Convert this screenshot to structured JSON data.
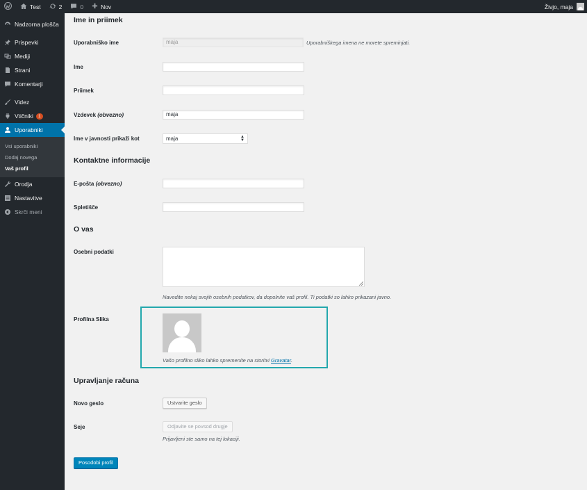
{
  "adminbar": {
    "site_name": "Test",
    "updates_count": "2",
    "comments_count": "0",
    "new_label": "Nov",
    "greeting": "Živjo, maja"
  },
  "sidebar": {
    "items": [
      {
        "label": "Nadzorna plošča",
        "icon": "dashboard-icon"
      },
      {
        "label": "Prispevki",
        "icon": "pin-icon"
      },
      {
        "label": "Mediji",
        "icon": "media-icon"
      },
      {
        "label": "Strani",
        "icon": "page-icon"
      },
      {
        "label": "Komentarji",
        "icon": "comment-icon"
      },
      {
        "label": "Videz",
        "icon": "brush-icon"
      },
      {
        "label": "Vtičniki",
        "icon": "plugin-icon",
        "badge": "1"
      },
      {
        "label": "Uporabniki",
        "icon": "user-icon"
      },
      {
        "label": "Orodja",
        "icon": "wrench-icon"
      },
      {
        "label": "Nastavitve",
        "icon": "settings-icon"
      },
      {
        "label": "Skrči meni",
        "icon": "collapse-icon"
      }
    ],
    "submenu": [
      "Vsi uporabniki",
      "Dodaj novega",
      "Vaš profil"
    ]
  },
  "name_section": {
    "heading": "Ime in priimek",
    "username_label": "Uporabniško ime",
    "username_value": "maja",
    "username_note": "Uporabniškega imena ne morete spreminjati.",
    "first_name_label": "Ime",
    "first_name_value": "",
    "last_name_label": "Priimek",
    "last_name_value": "",
    "nickname_label": "Vzdevek",
    "nickname_required": "(obvezno)",
    "nickname_value": "maja",
    "display_label": "Ime v javnosti prikaži kot",
    "display_value": "maja"
  },
  "contact_section": {
    "heading": "Kontaktne informacije",
    "email_label": "E-pošta",
    "email_required": "(obvezno)",
    "email_value": "",
    "website_label": "Spletišče",
    "website_value": ""
  },
  "about_section": {
    "heading": "O vas",
    "bio_label": "Osebni podatki",
    "bio_note": "Navedite nekaj svojih osebnih podatkov, da dopolnite vaš profil. Ti podatki so lahko prikazani javno.",
    "picture_label": "Profilna Slika",
    "picture_note_prefix": "Vašo profilno sliko lahko spremenite na storitvi ",
    "picture_link": "Gravatar",
    "picture_note_suffix": "."
  },
  "account_section": {
    "heading": "Upravljanje računa",
    "password_label": "Novo geslo",
    "password_button": "Ustvarite geslo",
    "sessions_label": "Seje",
    "sessions_button": "Odjavite se povsod drugje",
    "sessions_note": "Prijavljeni ste samo na tej lokaciji."
  },
  "submit_label": "Posodobi profil",
  "colors": {
    "accent": "#0073aa",
    "highlight": "#23a8ad",
    "sidebar_bg": "#23282d"
  }
}
